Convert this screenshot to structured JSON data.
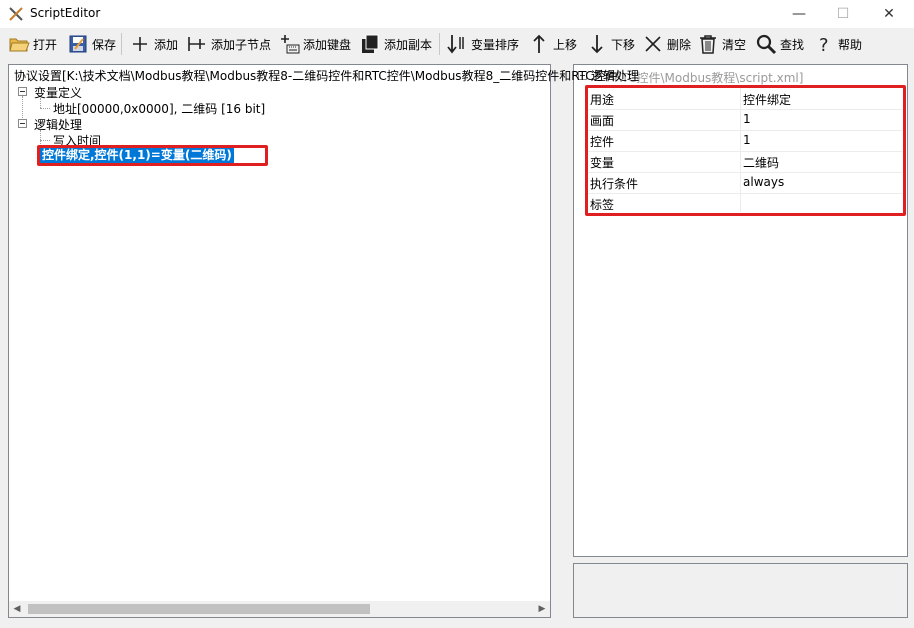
{
  "window": {
    "title": "ScriptEditor",
    "minimize": "—",
    "maximize": "☐",
    "close": "✕"
  },
  "toolbar": {
    "open": "打开",
    "save": "保存",
    "add": "添加",
    "add_child": "添加子节点",
    "add_keyboard": "添加键盘",
    "add_copy": "添加副本",
    "sort_vars": "变量排序",
    "move_up": "上移",
    "move_down": "下移",
    "delete": "删除",
    "clear": "清空",
    "find": "查找",
    "help": "帮助"
  },
  "tree": {
    "root": "协议设置[K:\\技术文档\\Modbus教程\\Modbus教程8-二维码控件和RTC控件\\Modbus教程8_二维码控件和RTC控件",
    "root_overlap": "RTC控件\\Modbus教程\\script.xml]",
    "var_def": "变量定义",
    "var_item": "地址[00000,0x0000], 二维码 [16 bit]",
    "logic": "逻辑处理",
    "write_time": "写入时间",
    "bind_item": "控件绑定,控件(1,1)=变量(二维码)"
  },
  "props": {
    "header": "逻辑处理",
    "rows": [
      {
        "key": "用途",
        "value": "控件绑定"
      },
      {
        "key": "画面",
        "value": "1"
      },
      {
        "key": "控件",
        "value": "1"
      },
      {
        "key": "变量",
        "value": "二维码"
      },
      {
        "key": "执行条件",
        "value": "always"
      },
      {
        "key": "标签",
        "value": ""
      }
    ]
  },
  "colors": {
    "accent": "#0078d7",
    "highlight_box": "#e02020"
  }
}
